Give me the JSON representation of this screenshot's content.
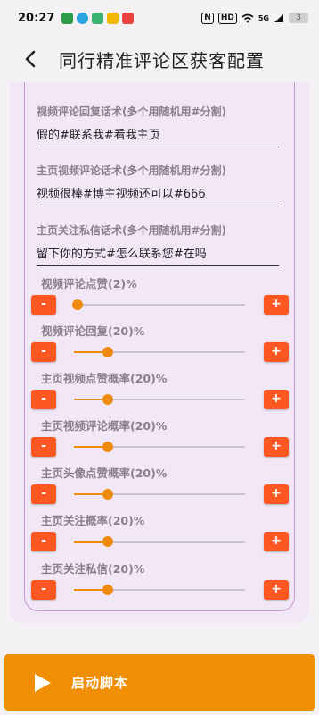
{
  "status_bar": {
    "time": "20:27",
    "icons": [
      "grid-app-icon",
      "telegram-icon",
      "messaging-app-icon",
      "qq-icon",
      "shopping-app-icon"
    ],
    "nfc": "N",
    "hd": "HD",
    "network": "5G",
    "battery": "3"
  },
  "app_bar": {
    "title": "同行精准评论区获客配置"
  },
  "fields": [
    {
      "label": "视频评论回复话术(多个用随机用#分割)",
      "value": "假的#联系我#看我主页"
    },
    {
      "label": "主页视频评论话术(多个用随机用#分割)",
      "value": "视频很棒#博主视频还可以#666"
    },
    {
      "label": "主页关注私信话术(多个用随机用#分割)",
      "value": "留下你的方式#怎么联系您#在吗"
    }
  ],
  "sliders": [
    {
      "label": "视频评论点赞(2)%",
      "value": 2
    },
    {
      "label": "视频评论回复(20)%",
      "value": 20
    },
    {
      "label": "主页视频点赞概率(20)%",
      "value": 20
    },
    {
      "label": "主页视频评论概率(20)%",
      "value": 20
    },
    {
      "label": "主页头像点赞概率(20)%",
      "value": 20
    },
    {
      "label": "主页关注概率(20)%",
      "value": 20
    },
    {
      "label": "主页关注私信(20)%",
      "value": 20
    }
  ],
  "stepper": {
    "minus": "-",
    "plus": "+"
  },
  "start_button": {
    "label": "启动脚本"
  },
  "colors": {
    "accent": "#ff5722",
    "slider": "#ef8a0c",
    "start": "#f18f04",
    "card": "#f1e7f6"
  }
}
